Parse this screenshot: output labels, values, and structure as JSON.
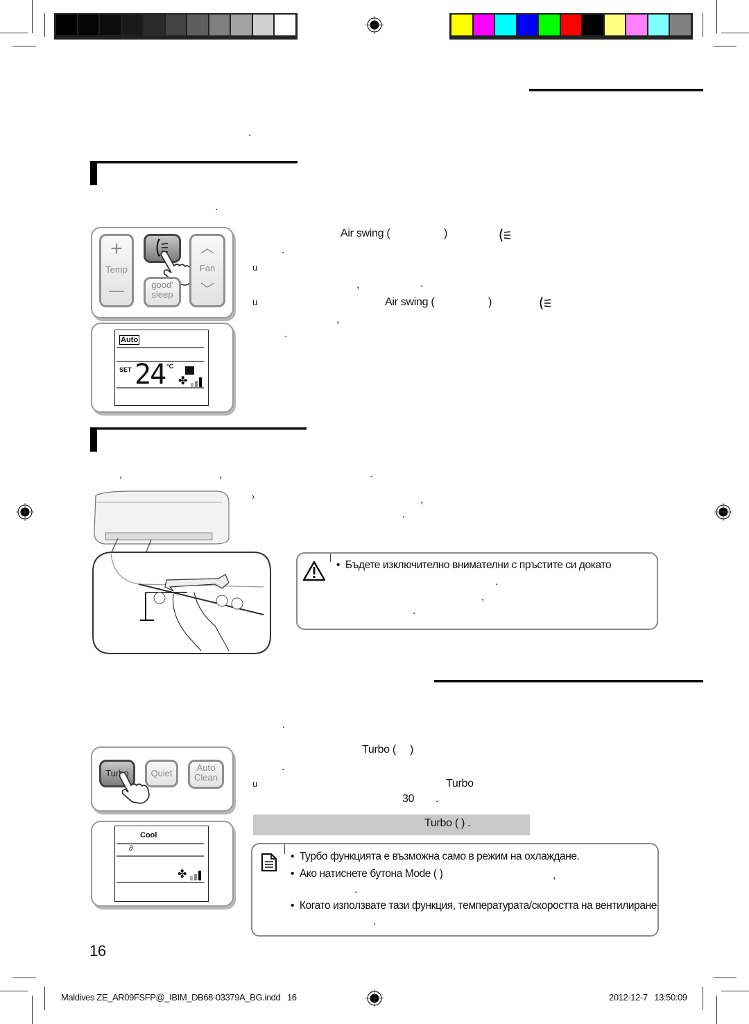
{
  "print_marks": {
    "grayscale_swatches": [
      "#000000",
      "#050505",
      "#0d0d0d",
      "#1a1a1a",
      "#2b2b2b",
      "#434343",
      "#5e5e5e",
      "#7f7f7f",
      "#a3a3a3",
      "#d0d0d0",
      "#ffffff"
    ],
    "color_swatches": [
      "#ffff00",
      "#ff00ff",
      "#00ffff",
      "#0000ff",
      "#00ff00",
      "#ff0000",
      "#000000",
      "#ffff80",
      "#ff80ff",
      "#80ffff",
      "#808080"
    ]
  },
  "section_air_swing": {
    "intro_dot": ".",
    "sub_dot": ".",
    "remote": {
      "temp_plus": "+",
      "temp_label": "Temp",
      "temp_minus": "—",
      "swing_icon": "air-swing-icon",
      "fan_label": "Fan",
      "good_sleep_line1": "good'",
      "good_sleep_line2": "sleep"
    },
    "display": {
      "mode": "Auto",
      "set_label": "SET",
      "temperature": "24",
      "unit": "°C"
    },
    "step1": {
      "button": "Air swing (",
      "close": ")",
      "dot": "."
    },
    "bullet1": {
      "marker": "u",
      "comma": ",",
      "dot": "."
    },
    "bullet2": {
      "marker": "u",
      "button": "Air swing (",
      "close": ")",
      "comma": ",",
      "dot": "."
    }
  },
  "section_manual": {
    "intro": {
      "comma1": ",",
      "comma2": ",",
      "dot": "."
    },
    "step": {
      "marker": "›",
      "comma": ",",
      "dot": "."
    },
    "caution": {
      "icon": "warning-icon",
      "line1": "Бъдете изключително внимателни с пръстите си докато",
      "dot1": ".",
      "comma": ",",
      "dot2": "."
    }
  },
  "section_turbo": {
    "intro_dot": ".",
    "remote": {
      "turbo_label": "Turbo",
      "quiet_label": "Quiet",
      "auto_clean_line1": "Auto",
      "auto_clean_line2": "Clean"
    },
    "display": {
      "mode": "Cool"
    },
    "step1": {
      "button": "Turbo (",
      "close": ")",
      "dot": "."
    },
    "bullet1": {
      "marker": "u",
      "turbo": "Turbo",
      "minutes": "30",
      "dot": "."
    },
    "highlight": "Turbo (    ) .",
    "note": {
      "icon": "note-icon",
      "items": [
        "Турбо функцията е възможна само в режим на охлаждане.",
        "Ако натиснете бутона Mode (     )",
        "Когато използвате тази функция, температурата/скоростта на вентилиране"
      ],
      "comma": ",",
      "dot1": ".",
      "dot2": "."
    }
  },
  "page_number": "16",
  "footer": {
    "file": "Maldives ZE_AR09FSFP@_IBIM_DB68-03379A_BG.indd   16",
    "timestamp": "2012-12-7   13:50:09"
  }
}
